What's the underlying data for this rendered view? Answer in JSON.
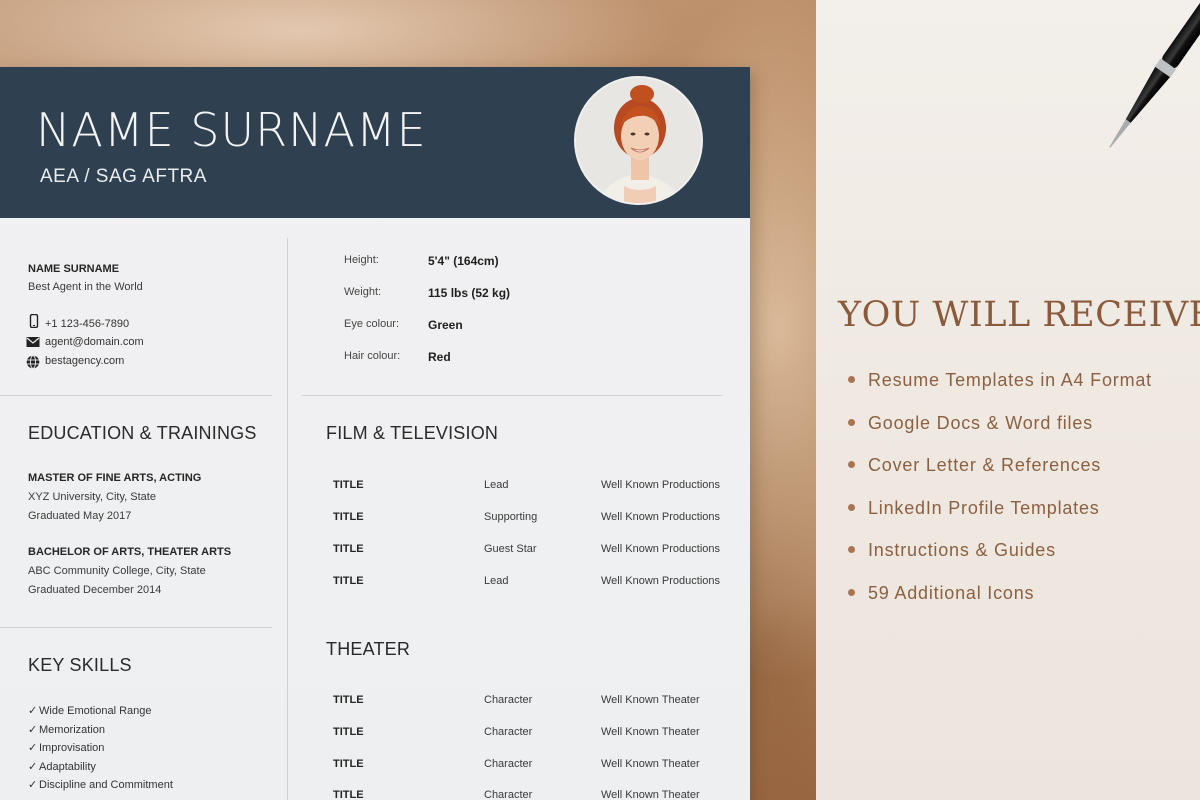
{
  "resume": {
    "name": "NAME SURNAME",
    "union": "AEA / SAG AFTRA",
    "agent": {
      "name": "NAME SURNAME",
      "title": "Best Agent in the World",
      "phone": "+1 123-456-7890",
      "email": "agent@domain.com",
      "website": "bestagency.com"
    },
    "attributes": [
      {
        "label": "Height:",
        "value": "5'4\" (164cm)"
      },
      {
        "label": "Weight:",
        "value": "115 lbs (52 kg)"
      },
      {
        "label": "Eye colour:",
        "value": "Green"
      },
      {
        "label": "Hair colour:",
        "value": "Red"
      }
    ],
    "education": {
      "heading": "EDUCATION & TRAININGS",
      "entries": [
        {
          "degree": "MASTER OF FINE ARTS, ACTING",
          "school": "XYZ University, City, State",
          "date": "Graduated May 2017"
        },
        {
          "degree": "BACHELOR OF ARTS, THEATER ARTS",
          "school": "ABC Community College, City, State",
          "date": "Graduated December 2014"
        }
      ]
    },
    "skills": {
      "heading": "KEY SKILLS",
      "items": [
        "Wide Emotional Range",
        "Memorization",
        "Improvisation",
        "Adaptability",
        "Discipline and Commitment"
      ]
    },
    "film": {
      "heading": "FILM & TELEVISION",
      "rows": [
        {
          "title": "TITLE",
          "role": "Lead",
          "production": "Well Known Productions"
        },
        {
          "title": "TITLE",
          "role": "Supporting",
          "production": "Well Known Productions"
        },
        {
          "title": "TITLE",
          "role": "Guest Star",
          "production": "Well Known Productions"
        },
        {
          "title": "TITLE",
          "role": "Lead",
          "production": "Well Known Productions"
        }
      ]
    },
    "theater": {
      "heading": "THEATER",
      "rows": [
        {
          "title": "TITLE",
          "role": "Character",
          "production": "Well Known Theater"
        },
        {
          "title": "TITLE",
          "role": "Character",
          "production": "Well Known Theater"
        },
        {
          "title": "TITLE",
          "role": "Character",
          "production": "Well Known Theater"
        },
        {
          "title": "TITLE",
          "role": "Character",
          "production": "Well Known Theater"
        }
      ]
    },
    "icons": {
      "phone": "phone-icon",
      "email": "envelope-icon",
      "website": "globe-icon",
      "skill": "check-icon"
    }
  },
  "promo": {
    "heading": "YOU WILL RECEIVE:",
    "items": [
      "Resume Templates in A4 Format",
      "Google Docs & Word files",
      "Cover Letter & References",
      "LinkedIn Profile Templates",
      "Instructions & Guides",
      "59 Additional Icons"
    ]
  },
  "colors": {
    "header": "#2f4150",
    "promo_text": "#8c6040",
    "promo_heading": "#8a5a3a"
  }
}
